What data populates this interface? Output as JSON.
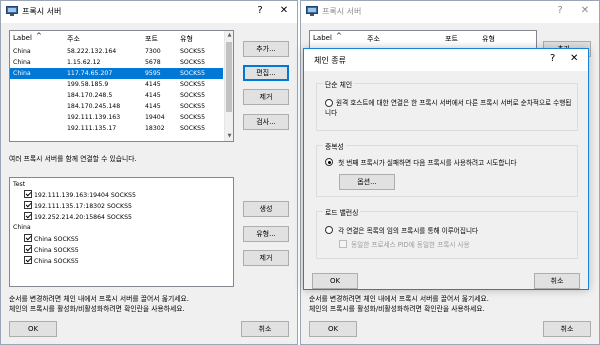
{
  "colors": {
    "accent": "#0078d7",
    "selection": "#0078d7",
    "window_bg": "#f0f0f0"
  },
  "left": {
    "title": "프록시 서버",
    "help_label": "?",
    "close_label": "✕",
    "columns": [
      "Label",
      "주소",
      "포트",
      "유형"
    ],
    "rows": [
      {
        "label": "China",
        "address": "58.222.132.164",
        "port": "7300",
        "type": "SOCKS5"
      },
      {
        "label": "China",
        "address": "1.15.62.12",
        "port": "5678",
        "type": "SOCKS5"
      },
      {
        "label": "China",
        "address": "117.74.65.207",
        "port": "9595",
        "type": "SOCKS5"
      },
      {
        "label": "",
        "address": "199.58.185.9",
        "port": "4145",
        "type": "SOCKS5"
      },
      {
        "label": "",
        "address": "184.170.248.5",
        "port": "4145",
        "type": "SOCKS5"
      },
      {
        "label": "",
        "address": "184.170.245.148",
        "port": "4145",
        "type": "SOCKS5"
      },
      {
        "label": "",
        "address": "192.111.139.163",
        "port": "19404",
        "type": "SOCKS5"
      },
      {
        "label": "",
        "address": "192.111.135.17",
        "port": "18302",
        "type": "SOCKS5"
      }
    ],
    "buttons": {
      "add": "추가...",
      "edit": "편집...",
      "remove": "제거",
      "check": "검사...",
      "create": "생성",
      "type": "유형...",
      "remove2": "제거",
      "ok": "OK",
      "cancel": "취소"
    },
    "chain_text": "여러 프록시 서버를 함께 연결할 수 있습니다.",
    "tree": {
      "group1": "Test",
      "group1_items": [
        "192.111.139.163:19404 SOCKS5",
        "192.111.135.17:18302 SOCKS5",
        "192.252.214.20:15864 SOCKS5"
      ],
      "group2": "China",
      "group2_items": [
        "China SOCKS5",
        "China SOCKS5",
        "China SOCKS5"
      ]
    },
    "footer_line1": "순서를 변경하려면 체인 내에서 프록시 서버를 끌어서 옮기세요.",
    "footer_line2": "체인의 프록시를 활성화/비활성화하려면 확인란을 사용하세요."
  },
  "right": {
    "title": "프록시 서버",
    "help_label": "?",
    "close_label": "✕",
    "columns": [
      "Label",
      "주소",
      "포트",
      "유형"
    ],
    "add_label": "추가...",
    "ok": "OK",
    "cancel": "취소",
    "footer_line1": "순서를 변경하려면 체인 내에서 프록시 서버를 끌어서 옮기세요.",
    "footer_line2": "체인의 프록시를 활성화/비활성화하려면 확인란을 사용하세요."
  },
  "dialog": {
    "title": "체인 종류",
    "help_label": "?",
    "close_label": "✕",
    "group1_title": "단순 체인",
    "group1_option": "원격 호스트에 대한 연결은 한 프록시 서버에서 다른 프록시 서버로 순차적으로 수행됩니다",
    "group2_title": "중복성",
    "group2_option": "첫 번째 프록시가 실패하면 다음 프록시를 사용하려고 시도합니다",
    "options_button": "옵션...",
    "group3_title": "로드 밸런싱",
    "group3_option": "각 연결은 목록의 임의 프록시를 통해 이루어집니다",
    "group3_sub": "동일한 프로세스 PID에 동일한 프록시 사용",
    "ok": "OK",
    "cancel": "취소"
  }
}
